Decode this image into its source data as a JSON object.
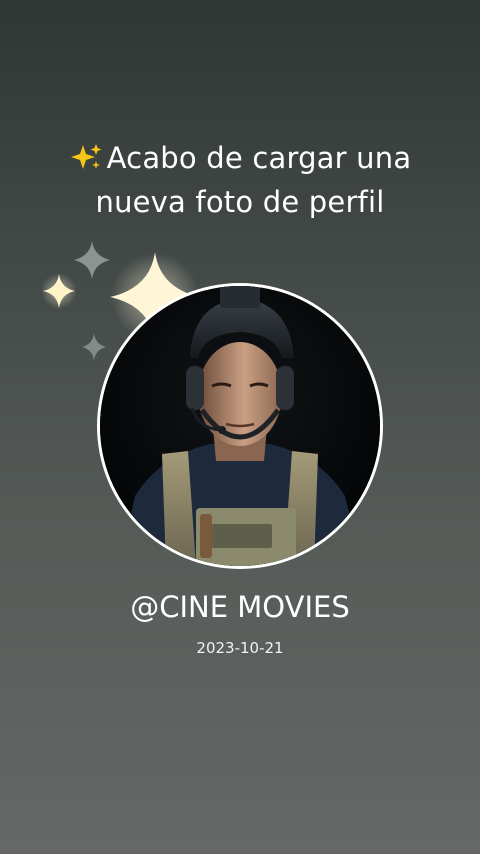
{
  "post": {
    "title_line1": "Acabo de cargar una",
    "title_line2": "nueva foto de perfil",
    "title_emoji": "sparkles-icon",
    "handle": "@CINE MOVIES",
    "date": "2023-10-21"
  },
  "colors": {
    "background_top": "#2f3634",
    "background_bottom": "#656866",
    "text": "#ffffff",
    "avatar_ring": "#ffffff",
    "sparkle": "#fff6d8"
  }
}
